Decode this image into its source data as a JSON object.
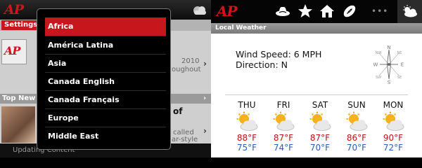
{
  "left_app": {
    "logo": "AP",
    "tab_settings": "Settings",
    "snippet_year": "2010",
    "snippet_word": "oughout",
    "section_label": "Top New",
    "headline_fragment": "of",
    "snippet_called": "called",
    "snippet_ar_style": "ar-style",
    "status_text": "Updating Content",
    "region_menu": {
      "items": [
        "Africa",
        "América Latina",
        "Asia",
        "Canada English",
        "Canada Français",
        "Europe",
        "Middle East"
      ],
      "selected": "Africa"
    }
  },
  "right_app": {
    "logo": "AP",
    "toolbar_icons": [
      "cowboy-hat-icon",
      "star-icon",
      "home-icon",
      "football-icon",
      "more-dots-icon",
      "weather-icon"
    ],
    "more_label": "•••",
    "section_title": "Local Weather",
    "wind_speed": "Wind Speed: 6 MPH",
    "direction": "Direction: N",
    "compass_labels": {
      "n": "N",
      "s": "S",
      "e": "E",
      "w": "W",
      "nw": "NW",
      "ne": "NE",
      "sw": "SW",
      "se": "SE"
    },
    "forecast": [
      {
        "day": "THU",
        "high": "88°F",
        "low": "75°F",
        "icon": "sun-cloud-icon"
      },
      {
        "day": "FRI",
        "high": "87°F",
        "low": "74°F",
        "icon": "sun-cloud-icon"
      },
      {
        "day": "SAT",
        "high": "87°F",
        "low": "70°F",
        "icon": "sun-cloud-icon"
      },
      {
        "day": "SUN",
        "high": "86°F",
        "low": "70°F",
        "icon": "sun-cloud-icon"
      },
      {
        "day": "MON",
        "high": "90°F",
        "low": "72°F",
        "icon": "sun-cloud-icon"
      }
    ]
  },
  "colors": {
    "ap_red": "#d0141a",
    "selected_red": "#c8161d",
    "high_temp": "#b3161b",
    "low_temp": "#2a5db0"
  }
}
